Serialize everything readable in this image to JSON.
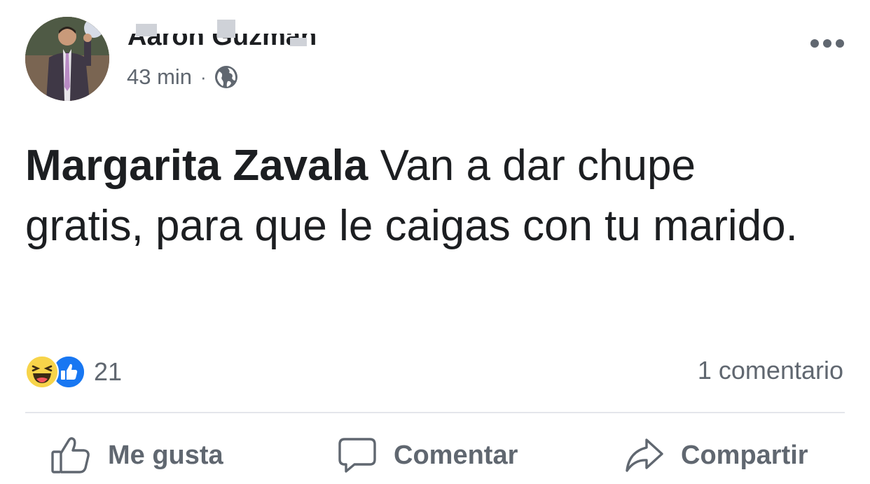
{
  "post": {
    "author_name": "Aaron Guzman",
    "timestamp": "43 min",
    "separator": "·",
    "privacy_icon": "globe-icon",
    "more_icon": "more-options-icon",
    "text": {
      "mention": "Margarita Zavala",
      "body": " Van a dar chupe gratis, para que le caigas con tu marido."
    },
    "reactions": {
      "icons": [
        "laugh-reaction-icon",
        "like-reaction-icon"
      ],
      "count": "21"
    },
    "comments_count": "1 comentario"
  },
  "actions": {
    "like_label": "Me gusta",
    "comment_label": "Comentar",
    "share_label": "Compartir"
  },
  "colors": {
    "text_primary": "#1c1e21",
    "text_secondary": "#606770",
    "like_blue": "#1877f2",
    "haha_yellow": "#f7d44a",
    "divider": "#e4e6eb"
  }
}
